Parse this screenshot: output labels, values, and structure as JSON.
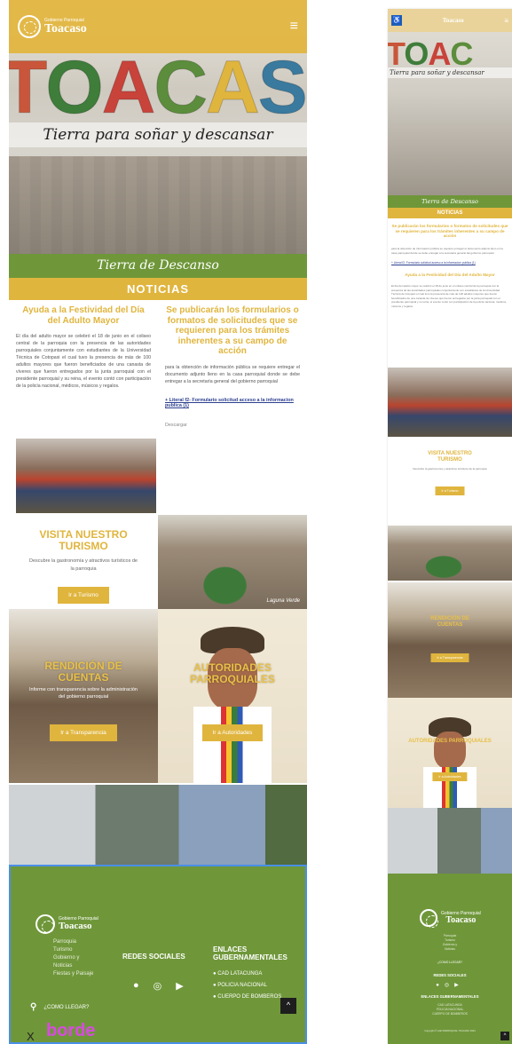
{
  "brand": {
    "small": "Gobierno Parroquial",
    "name": "Toacaso"
  },
  "hero": {
    "letters": [
      "T",
      "O",
      "A",
      "C",
      "A",
      "S",
      "O"
    ],
    "letter_colors": [
      "#c9563a",
      "#3f7d3a",
      "#c8433a",
      "#5c8d3c",
      "#e0b53e",
      "#3a7a9e",
      "#7a9a3a"
    ],
    "slogan": "Tierra para soñar y descansar",
    "subtitle": "Tierra de Descanso"
  },
  "news": {
    "band": "NOTICIAS",
    "left": {
      "title": "Ayuda a la Festividad del Día del Adulto Mayor",
      "body": "El día del adulto mayor se celebró el 18 de junio en el coliseo central de la parroquia con la presencia de las autoridades parroquiales conjuntamente con estudiantes de la Universidad Técnica de Cotopaxi el cual tuvo la presencia de más de 100 adultos mayores que fueron beneficiados de una canasta de víveres que fueron entregados por la junta parroquial con el presidente parroquial y su reina, el evento contó con participación de la policía nacional, médicos, músicos y regalos."
    },
    "right": {
      "title": "Se publicarán los formularios o formatos de solicitudes que se requieren para los trámites inherentes a su campo de acción",
      "body": "para la obtención de información pública se requiere entregar el documento adjunto lleno en la casa parroquial donde se debe entregar a la secretaría general del gobierno parroquial",
      "link": "+ Literal f2- Formulario solicitud acceso a la informacion publica (1)",
      "download": "Descargar"
    }
  },
  "turismo": {
    "title": "VISITA NUESTRO TURISMO",
    "subtitle": "Descubre la gastronomía y atractivos turísticos de la parroquia",
    "button": "Ir a Turismo",
    "lake_caption": "Laguna Verde"
  },
  "rendicion": {
    "title": "RENDICIÓN DE CUENTAS",
    "subtitle": "Informe con transparencia sobre la administración del gobierno parroquial",
    "button": "Ir a Transparencia"
  },
  "autoridades": {
    "title": "AUTORIDADES PARROQUIALES",
    "button": "Ir a Autoridades"
  },
  "footer": {
    "links": [
      "Parroquia",
      "Turismo",
      "Gobierno y",
      "Noticias",
      "Fiestas y Paisaje"
    ],
    "social_heading": "REDES SOCIALES",
    "social_icons": [
      "facebook-icon",
      "instagram-icon",
      "youtube-icon"
    ],
    "gov_heading": "ENLACES GUBERNAMENTALES",
    "gov_links": [
      "CAD LATACUNGA",
      "POLICIA NACIONAL",
      "CUERPO DE BOMBEROS"
    ],
    "location": "¿COMO LLEGAR?",
    "borde": "borde",
    "x": "X",
    "up": "^",
    "copyright": "Copyright © GAD PARROQUIAL TOACASO 2023"
  },
  "colors": {
    "gold": "#e0b53e",
    "green": "#6f973a",
    "header": "#e2b43c"
  }
}
